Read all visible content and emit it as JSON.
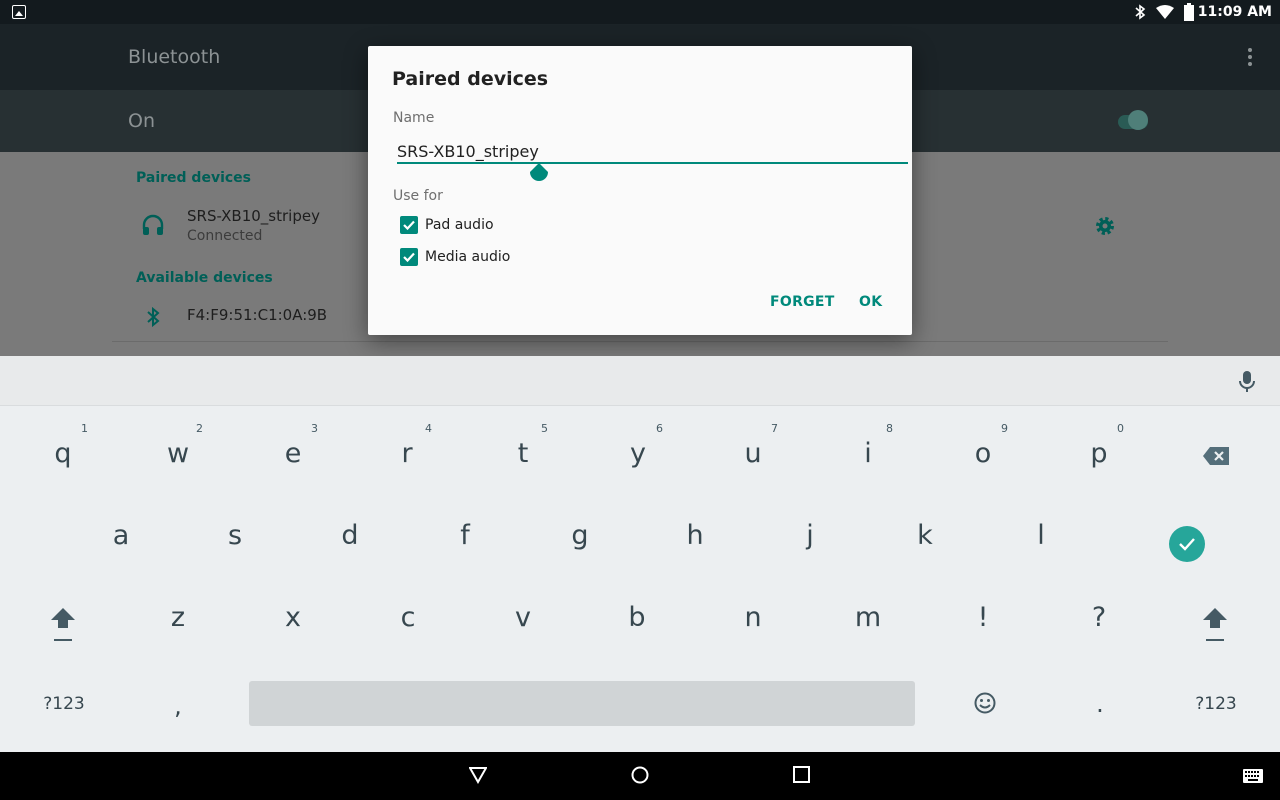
{
  "status_bar": {
    "time": "11:09 AM",
    "icons": [
      "image-notification-icon",
      "bluetooth-icon",
      "wifi-icon",
      "battery-icon"
    ]
  },
  "toolbar": {
    "title": "Bluetooth"
  },
  "switch_bar": {
    "label": "On",
    "switch_state": "on"
  },
  "paired_section": {
    "header": "Paired devices",
    "devices": [
      {
        "name": "SRS-XB10_stripey",
        "status": "Connected",
        "icon": "headphones-icon"
      }
    ]
  },
  "available_section": {
    "header": "Available devices",
    "devices": [
      {
        "name": "F4:F9:51:C1:0A:9B",
        "icon": "bluetooth-icon"
      }
    ]
  },
  "dialog": {
    "title": "Paired devices",
    "name_label": "Name",
    "name_value": "SRS-XB10_stripey",
    "use_for_label": "Use for",
    "options": [
      {
        "label": "Pad audio",
        "checked": true
      },
      {
        "label": "Media audio",
        "checked": true
      }
    ],
    "forget_label": "FORGET",
    "ok_label": "OK"
  },
  "keyboard": {
    "row1": [
      {
        "k": "q",
        "h": "1"
      },
      {
        "k": "w",
        "h": "2"
      },
      {
        "k": "e",
        "h": "3"
      },
      {
        "k": "r",
        "h": "4"
      },
      {
        "k": "t",
        "h": "5"
      },
      {
        "k": "y",
        "h": "6"
      },
      {
        "k": "u",
        "h": "7"
      },
      {
        "k": "i",
        "h": "8"
      },
      {
        "k": "o",
        "h": "9"
      },
      {
        "k": "p",
        "h": "0"
      }
    ],
    "row2": [
      "a",
      "s",
      "d",
      "f",
      "g",
      "h",
      "j",
      "k",
      "l"
    ],
    "row3": [
      "z",
      "x",
      "c",
      "v",
      "b",
      "n",
      "m",
      "!",
      "?"
    ],
    "symbols_label": "?123",
    "comma": ",",
    "period": ".",
    "accent_color": "#26a69a"
  },
  "colors": {
    "accent": "#00897b",
    "status_bar": "#131a1e",
    "toolbar": "#1b2327",
    "keyboard_bg": "#eceff1"
  }
}
